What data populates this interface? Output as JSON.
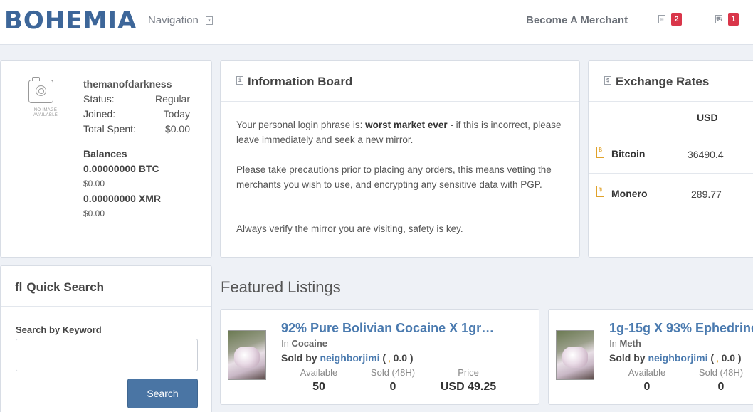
{
  "header": {
    "logo": "BOHEMIA",
    "navigation_label": "Navigation",
    "become_merchant_label": "Become A Merchant",
    "notifications": [
      {
        "icon": "envelope-icon",
        "count": "2"
      },
      {
        "icon": "cart-icon",
        "count": "1"
      }
    ]
  },
  "profile": {
    "no_image_text": "NO IMAGE AVAILABLE",
    "username": "themanofdarkness",
    "status_label": "Status:",
    "status_value": "Regular",
    "joined_label": "Joined:",
    "joined_value": "Today",
    "spent_label": "Total Spent:",
    "spent_value": "$0.00",
    "balances_title": "Balances",
    "balances": [
      {
        "amount": "0.00000000 BTC",
        "usd": "$0.00"
      },
      {
        "amount": "0.00000000 XMR",
        "usd": "$0.00"
      }
    ]
  },
  "info_board": {
    "title": "Information Board",
    "p1_prefix": "Your personal login phrase is: ",
    "p1_phrase": "worst market ever",
    "p1_suffix": " - if this is incorrect, please leave immediately and seek a new mirror.",
    "p2": "Please take precautions prior to placing any orders, this means vetting the merchants you wish to use, and encrypting any sensitive data with PGP.",
    "p3": "Always verify the mirror you are visiting, safety is key."
  },
  "exchange": {
    "title": "Exchange Rates",
    "currency": "USD",
    "rates": [
      {
        "coin": "Bitcoin",
        "rate": "36490.4",
        "icon": "bitcoin-icon"
      },
      {
        "coin": "Monero",
        "rate": "289.77",
        "icon": "monero-icon"
      }
    ]
  },
  "quick_search": {
    "title": "Quick Search",
    "keyword_label": "Search by Keyword",
    "input_value": "",
    "button_label": "Search"
  },
  "featured": {
    "title": "Featured Listings",
    "listings": [
      {
        "title": "92% Pure Bolivian Cocaine X 1gr…",
        "category_prefix": "In ",
        "category": "Cocaine",
        "sold_by_label": "Sold by ",
        "seller": "neighborjimi",
        "rating_open": " ( ",
        "rating": "0.0",
        "rating_close": " )",
        "available_label": "Available",
        "available": "50",
        "sold_label": "Sold (48H)",
        "sold": "0",
        "price_label": "Price",
        "price": "USD 49.25"
      },
      {
        "title": "1g-15g X 93% Ephedrine",
        "category_prefix": "In ",
        "category": "Meth",
        "sold_by_label": "Sold by ",
        "seller": "neighborjimi",
        "rating_open": " ( ",
        "rating": "0.0",
        "rating_close": " )",
        "available_label": "Available",
        "available": "0",
        "sold_label": "Sold (48H)",
        "sold": "0"
      }
    ]
  },
  "colors": {
    "brand": "#3d6699",
    "link": "#4a7aaf",
    "badge": "#d9364a",
    "button": "#4a75a4",
    "coin": "#e0a22a"
  }
}
